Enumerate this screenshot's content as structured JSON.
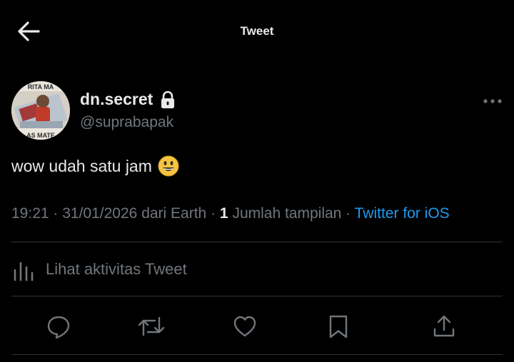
{
  "header": {
    "title": "Tweet",
    "back_icon": "arrow-left-icon"
  },
  "author": {
    "display_name": "dn.secret",
    "handle": "@suprabapak",
    "protected_icon": "lock-icon",
    "avatar_text_top": "RITA MA",
    "avatar_text_bottom": "AS MATE",
    "more_icon": "more-horizontal-icon"
  },
  "tweet": {
    "text": "wow udah satu jam",
    "emoji": "smiling-face-icon"
  },
  "meta": {
    "time": "19:21",
    "date": "31/01/2026",
    "location": "dari Earth",
    "separator": " · ",
    "views_count": "1",
    "views_label": "Jumlah tampilan",
    "source": "Twitter for iOS"
  },
  "activity": {
    "label": "Lihat aktivitas Tweet",
    "icon": "analytics-icon"
  },
  "actions": [
    {
      "name": "reply",
      "icon": "reply-icon"
    },
    {
      "name": "retweet",
      "icon": "retweet-icon"
    },
    {
      "name": "like",
      "icon": "heart-icon"
    },
    {
      "name": "bookmark",
      "icon": "bookmark-icon"
    },
    {
      "name": "share",
      "icon": "share-icon"
    }
  ],
  "colors": {
    "background": "#000000",
    "text_primary": "#e7e9ea",
    "text_secondary": "#71767b",
    "accent": "#1d9bf0",
    "divider": "#2f3336"
  }
}
